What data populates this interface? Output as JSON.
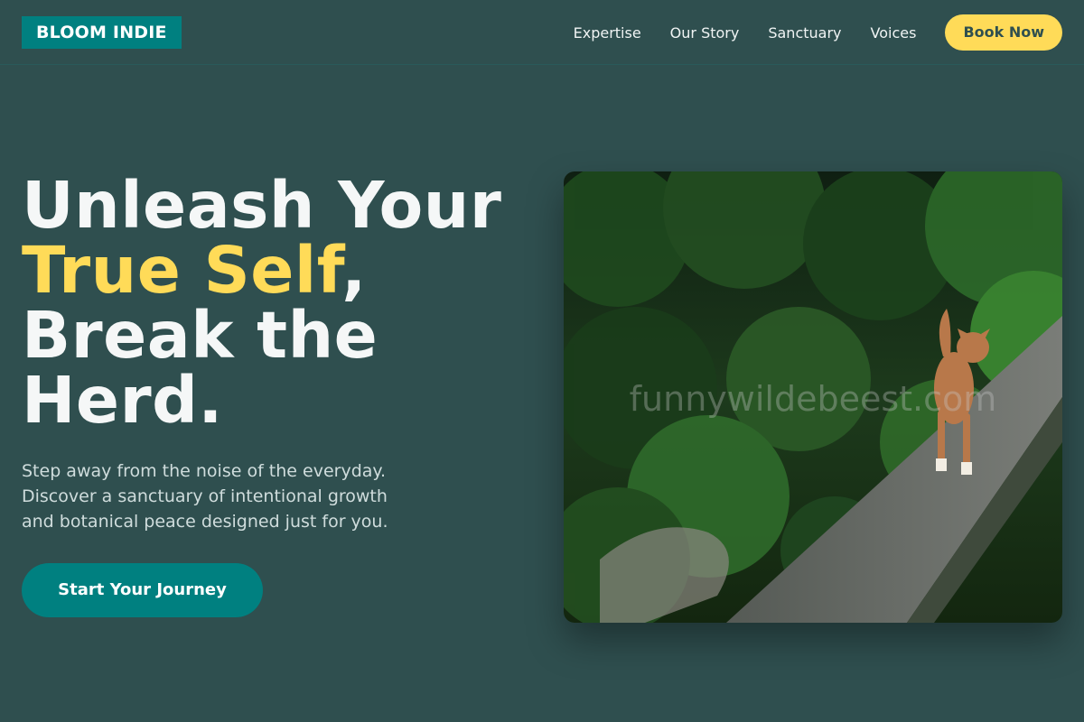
{
  "brand": {
    "logo_text": "BLOOM INDIE",
    "primary_color": "#008080",
    "accent_color": "#ffdb58",
    "background_color": "#2f4f4f"
  },
  "nav": {
    "links": [
      "Expertise",
      "Our Story",
      "Sanctuary",
      "Voices"
    ],
    "cta_label": "Book Now"
  },
  "hero": {
    "headline_line1": "Unleash Your",
    "headline_accent": "True Self",
    "headline_comma": ",",
    "headline_line3": "Break the",
    "headline_line4": "Herd.",
    "subtext": "Step away from the noise of the everyday. Discover a sanctuary of intentional growth and botanical peace designed just for you.",
    "cta_label": "Start Your Journey",
    "image": {
      "subject": "dog standing on a stone wall in a lush jungle",
      "watermark": "funnywildebeest.com"
    }
  }
}
